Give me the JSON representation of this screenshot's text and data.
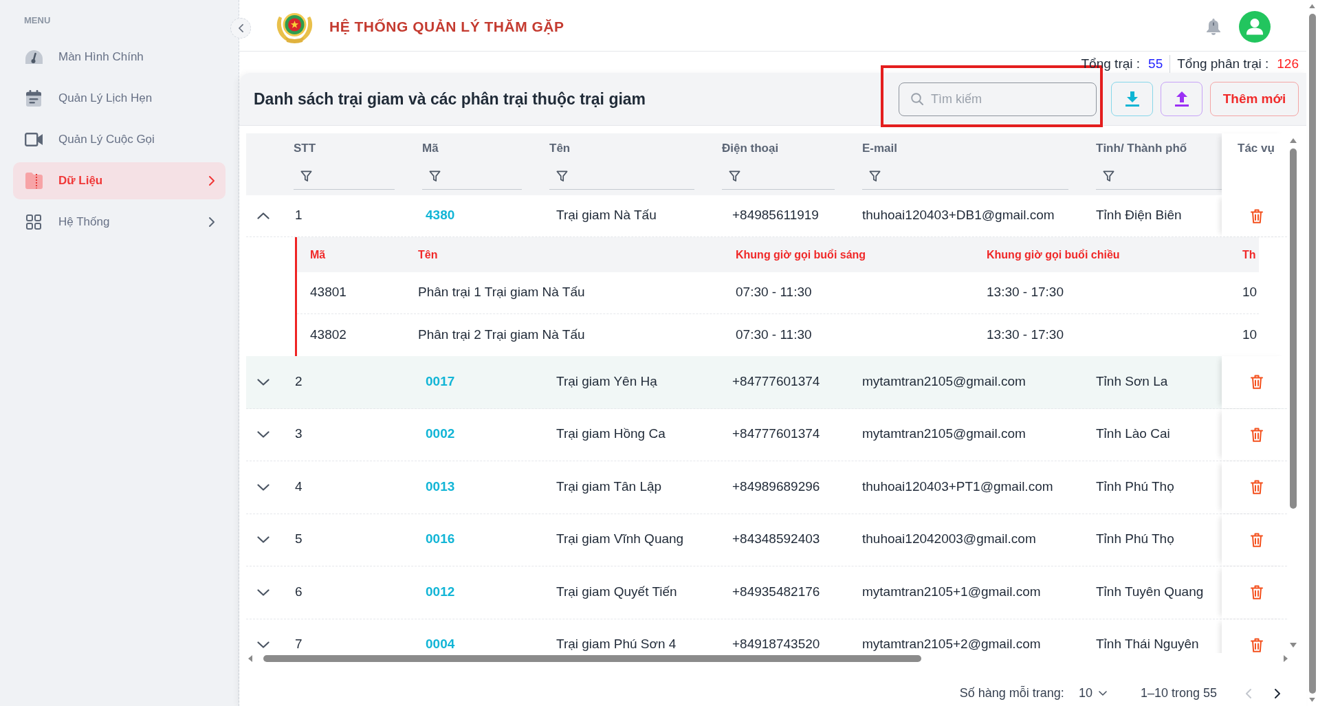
{
  "sidebar": {
    "heading": "MENU",
    "items": [
      {
        "label": "Màn Hình Chính",
        "selected": false,
        "expandable": false
      },
      {
        "label": "Quản Lý Lịch Hẹn",
        "selected": false,
        "expandable": false
      },
      {
        "label": "Quản Lý Cuộc Gọi",
        "selected": false,
        "expandable": false
      },
      {
        "label": "Dữ Liệu",
        "selected": true,
        "expandable": true
      },
      {
        "label": "Hệ Thống",
        "selected": false,
        "expandable": true
      }
    ]
  },
  "header": {
    "title": "HỆ THỐNG QUẢN LÝ THĂM GẶP"
  },
  "totals": [
    {
      "label": "Tổng trại :",
      "value": "55",
      "color": "#2323ff"
    },
    {
      "label": "Tổng phân trại :",
      "value": "126",
      "color": "#ff1f1f"
    }
  ],
  "panel": {
    "title": "Danh sách trại giam và các phân trại thuộc trại giam",
    "search": {
      "placeholder": "Tìm kiếm",
      "highlighted": true
    },
    "actions": [
      {
        "kind": "download"
      },
      {
        "kind": "upload"
      },
      {
        "kind": "add",
        "label": "Thêm mới"
      }
    ]
  },
  "table": {
    "columns": [
      {
        "label": "STT",
        "filterable": true
      },
      {
        "label": "Mã",
        "filterable": true
      },
      {
        "label": "Tên",
        "filterable": true
      },
      {
        "label": "Điện thoại",
        "filterable": true
      },
      {
        "label": "E-mail",
        "filterable": true
      },
      {
        "label": "Tỉnh/ Thành phố",
        "filterable": true
      },
      {
        "label": "Tác vụ",
        "filterable": false
      }
    ],
    "rows": [
      {
        "cells": [
          "1",
          "4380",
          "Trại giam Nà Tấu",
          "+84985611919",
          "thuhoai120403+DB1@gmail.com",
          "Tỉnh Điện Biên"
        ],
        "expanded": true,
        "highlighted": false,
        "branches": {
          "columns": [
            "Mã",
            "Tên",
            "Khung giờ gọi buổi sáng",
            "Khung giờ gọi buổi chiều",
            "Th"
          ],
          "rows": [
            {
              "cells": [
                "43801",
                "Phân trại 1 Trại giam Nà Tấu",
                "07:30 - 11:30",
                "13:30 - 17:30",
                "10"
              ]
            },
            {
              "cells": [
                "43802",
                "Phân trại 2 Trại giam Nà Tấu",
                "07:30 - 11:30",
                "13:30 - 17:30",
                "10"
              ]
            }
          ]
        }
      },
      {
        "cells": [
          "2",
          "0017",
          "Trại giam Yên Hạ",
          "+84777601374",
          "mytamtran2105@gmail.com",
          "Tỉnh Sơn La"
        ],
        "expanded": false,
        "highlighted": true
      },
      {
        "cells": [
          "3",
          "0002",
          "Trại giam Hồng Ca",
          "+84777601374",
          "mytamtran2105@gmail.com",
          "Tỉnh Lào Cai"
        ],
        "expanded": false,
        "highlighted": false
      },
      {
        "cells": [
          "4",
          "0013",
          "Trại giam Tân Lập",
          "+84989689296",
          "thuhoai120403+PT1@gmail.com",
          "Tỉnh Phú Thọ"
        ],
        "expanded": false,
        "highlighted": false
      },
      {
        "cells": [
          "5",
          "0016",
          "Trại giam Vĩnh Quang",
          "+84348592403",
          "thuhoai12042003@gmail.com",
          "Tỉnh Phú Thọ"
        ],
        "expanded": false,
        "highlighted": false
      },
      {
        "cells": [
          "6",
          "0012",
          "Trại giam Quyết Tiến",
          "+84935482176",
          "mytamtran2105+1@gmail.com",
          "Tỉnh Tuyên Quang"
        ],
        "expanded": false,
        "highlighted": false
      },
      {
        "cells": [
          "7",
          "0004",
          "Trại giam Phú Sơn 4",
          "+84918743520",
          "mytamtran2105+2@gmail.com",
          "Tỉnh Thái Nguyên"
        ],
        "expanded": false,
        "highlighted": false
      }
    ]
  },
  "pagination": {
    "rows_per_page_label": "Số hàng mỗi trang:",
    "rows_per_page": "10",
    "range": "1–10 trong 55",
    "prev_disabled": true,
    "next_disabled": false
  }
}
